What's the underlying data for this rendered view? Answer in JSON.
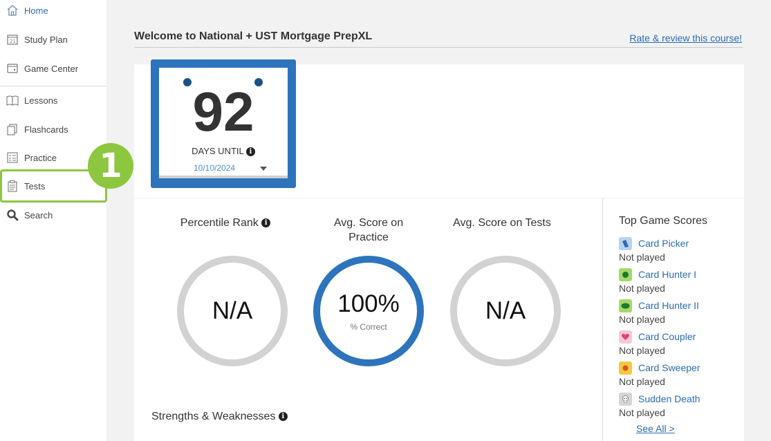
{
  "sidebar": {
    "items": [
      {
        "label": "Home",
        "icon": "home-icon"
      },
      {
        "label": "Study Plan",
        "icon": "calendar-icon"
      },
      {
        "label": "Game Center",
        "icon": "game-icon"
      },
      {
        "label": "Lessons",
        "icon": "book-icon"
      },
      {
        "label": "Flashcards",
        "icon": "flashcards-icon"
      },
      {
        "label": "Practice",
        "icon": "checklist-icon"
      },
      {
        "label": "Tests",
        "icon": "clipboard-icon"
      },
      {
        "label": "Search",
        "icon": "search-icon"
      }
    ],
    "highlight_step": "1",
    "highlight_color": "#8dc63f"
  },
  "header": {
    "title": "Welcome to National + UST Mortgage PrepXL",
    "rate_link": "Rate & review this course!"
  },
  "countdown": {
    "days": "92",
    "label": "DAYS UNTIL",
    "date": "10/10/2024"
  },
  "stats": {
    "percentile": {
      "label": "Percentile Rank",
      "value": "N/A"
    },
    "practice": {
      "label": "Avg. Score on Practice",
      "value": "100%",
      "sub": "% Correct"
    },
    "tests": {
      "label": "Avg. Score on Tests",
      "value": "N/A"
    }
  },
  "strengths_title": "Strengths & Weaknesses",
  "games": {
    "title": "Top Game Scores",
    "items": [
      {
        "name": "Card Picker",
        "status": "Not played",
        "icon": "card-picker-icon"
      },
      {
        "name": "Card Hunter I",
        "status": "Not played",
        "icon": "card-hunter-icon"
      },
      {
        "name": "Card Hunter II",
        "status": "Not played",
        "icon": "card-hunter-2-icon"
      },
      {
        "name": "Card Coupler",
        "status": "Not played",
        "icon": "heart-icon"
      },
      {
        "name": "Card Sweeper",
        "status": "Not played",
        "icon": "sweeper-icon"
      },
      {
        "name": "Sudden Death",
        "status": "Not played",
        "icon": "skull-icon"
      }
    ],
    "see_all": "See All >"
  },
  "colors": {
    "accent": "#2a6bb5",
    "calendar": "#2d74bc",
    "highlight": "#8dc63f"
  }
}
